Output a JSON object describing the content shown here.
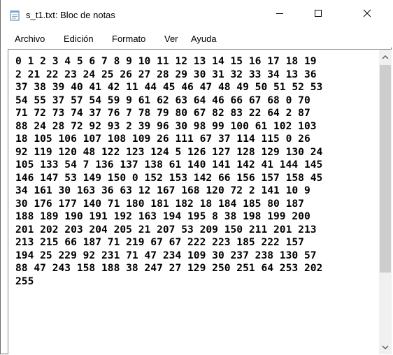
{
  "window": {
    "title": "s_t1.txt: Bloc de notas"
  },
  "menu": {
    "items": [
      "Archivo",
      "Edición",
      "Formato",
      "Ver",
      "Ayuda"
    ]
  },
  "editor": {
    "lines": [
      "0 1 2 3 4 5 6 7 8 9 10 11 12 13 14 15 16 17 18 19",
      "2 21 22 23 24 25 26 27 28 29 30 31 32 33 34 13 36",
      "37 38 39 40 41 42 11 44 45 46 47 48 49 50 51 52 53",
      "54 55 37 57 54 59 9 61 62 63 64 46 66 67 68 0 70",
      "71 72 73 74 37 76 7 78 79 80 67 82 83 22 64 2 87",
      "88 24 28 72 92 93 2 39 96 30 98 99 100 61 102 103",
      "18 105 106 107 108 109 26 111 67 37 114 115 0 26",
      "92 119 120 48 122 123 124 5 126 127 128 129 130 24",
      "105 133 54 7 136 137 138 61 140 141 142 41 144 145",
      "146 147 53 149 150 0 152 153 142 66 156 157 158 45",
      "34 161 30 163 36 63 12 167 168 120 72 2 141 10 9",
      "30 176 177 140 71 180 181 182 18 184 185 80 187",
      "188 189 190 191 192 163 194 195 8 38 198 199 200",
      "201 202 203 204 205 21 207 53 209 150 211 201 213",
      "213 215 66 187 71 219 67 67 222 223 185 222 157",
      "194 25 229 92 231 71 47 234 109 30 237 238 130 57",
      "88 47 243 158 188 38 247 27 129 250 251 64 253 202",
      "255"
    ]
  },
  "icons": {
    "app": "notepad-icon",
    "minimize": "minimize-icon",
    "maximize": "maximize-icon",
    "close": "close-icon",
    "scroll_up": "chevron-up-icon",
    "scroll_down": "chevron-down-icon"
  }
}
